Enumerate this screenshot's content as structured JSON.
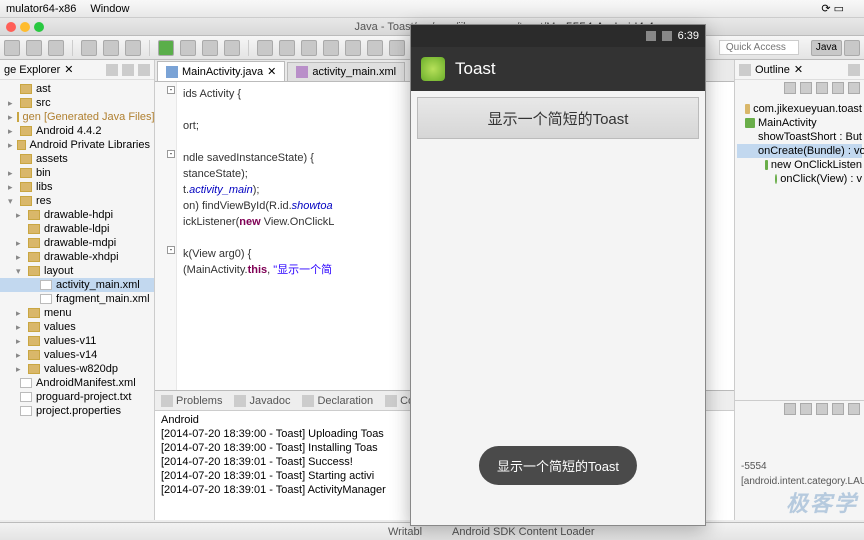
{
  "menu": {
    "item1": "mulator64-x86",
    "item2": "Window"
  },
  "titlebar": {
    "center": "Java - Toast/src/com/jikexueyuan/toast/M",
    "emu": "5554:Android4.4"
  },
  "toolbar": {
    "quickaccess_ph": "Quick Access",
    "persp": "Java"
  },
  "leftpane": {
    "title": "ge Explorer"
  },
  "tree": [
    {
      "t": "ast",
      "d": 0,
      "a": ""
    },
    {
      "t": "src",
      "d": 0,
      "a": "▸"
    },
    {
      "t": "gen [Generated Java Files]",
      "d": 0,
      "a": "▸",
      "cls": "gen"
    },
    {
      "t": "Android 4.4.2",
      "d": 0,
      "a": "▸"
    },
    {
      "t": "Android Private Libraries",
      "d": 0,
      "a": "▸"
    },
    {
      "t": "assets",
      "d": 0,
      "a": ""
    },
    {
      "t": "bin",
      "d": 0,
      "a": "▸"
    },
    {
      "t": "libs",
      "d": 0,
      "a": "▸"
    },
    {
      "t": "res",
      "d": 0,
      "a": "▾"
    },
    {
      "t": "drawable-hdpi",
      "d": 1,
      "a": "▸"
    },
    {
      "t": "drawable-ldpi",
      "d": 1,
      "a": ""
    },
    {
      "t": "drawable-mdpi",
      "d": 1,
      "a": "▸"
    },
    {
      "t": "drawable-xhdpi",
      "d": 1,
      "a": "▸"
    },
    {
      "t": "layout",
      "d": 1,
      "a": "▾"
    },
    {
      "t": "activity_main.xml",
      "d": 2,
      "a": "",
      "sel": true,
      "file": true
    },
    {
      "t": "fragment_main.xml",
      "d": 2,
      "a": "",
      "file": true
    },
    {
      "t": "menu",
      "d": 1,
      "a": "▸"
    },
    {
      "t": "values",
      "d": 1,
      "a": "▸"
    },
    {
      "t": "values-v11",
      "d": 1,
      "a": "▸"
    },
    {
      "t": "values-v14",
      "d": 1,
      "a": "▸"
    },
    {
      "t": "values-w820dp",
      "d": 1,
      "a": "▸"
    },
    {
      "t": "AndroidManifest.xml",
      "d": 0,
      "a": "",
      "file": true
    },
    {
      "t": "proguard-project.txt",
      "d": 0,
      "a": "",
      "file": true
    },
    {
      "t": "project.properties",
      "d": 0,
      "a": "",
      "file": true
    }
  ],
  "tabs": {
    "t1": "MainActivity.java",
    "t2": "activity_main.xml"
  },
  "code": {
    "l1": "ids Activity {",
    "l2": "ort;",
    "l3": "ndle savedInstanceState) {",
    "l4": "stanceState);",
    "l5a": "t.",
    "l5b": "activity_main",
    "l5c": ");",
    "l6a": "on) findViewById(R.id.",
    "l6b": "showtoa",
    "l7a": "ickListener(",
    "l7b": "new",
    "l7c": " View.OnClickL",
    "l8": "k(View arg0) {",
    "l9a": "(MainActivity.",
    "l9b": "this",
    "l9c": ", ",
    "l9d": "\"显示一个简"
  },
  "bottom": {
    "t1": "Problems",
    "t2": "Javadoc",
    "t3": "Declaration",
    "t4": "Consol",
    "title": "Android",
    "rows": [
      "[2014-07-20 18:39:00 - Toast] Uploading Toas",
      "[2014-07-20 18:39:00 - Toast] Installing Toas",
      "[2014-07-20 18:39:01 - Toast] Success!",
      "[2014-07-20 18:39:01 - Toast] Starting activi",
      "[2014-07-20 18:39:01 - Toast] ActivityManager"
    ]
  },
  "outline": {
    "title": "Outline",
    "items": [
      {
        "t": "com.jikexueyuan.toast",
        "d": 0,
        "ico": "pk"
      },
      {
        "t": "MainActivity",
        "d": 0,
        "ico": "cls"
      },
      {
        "t": "showToastShort : But",
        "d": 1,
        "ico": ""
      },
      {
        "t": "onCreate(Bundle) : vo",
        "d": 1,
        "ico": "",
        "sel": true
      },
      {
        "t": "new OnClickListen",
        "d": 2,
        "ico": "cls"
      },
      {
        "t": "onClick(View) : v",
        "d": 3,
        "ico": ""
      }
    ]
  },
  "rp2": {
    "l1": "-5554",
    "l2": "[android.intent.category.LAUNCH"
  },
  "status": {
    "s1": "Writabl",
    "s2": "Android SDK Content Loader"
  },
  "emulator": {
    "time": "6:39",
    "apptitle": "Toast",
    "button": "显示一个简短的Toast",
    "toast": "显示一个简短的Toast"
  },
  "watermark": "极客学"
}
